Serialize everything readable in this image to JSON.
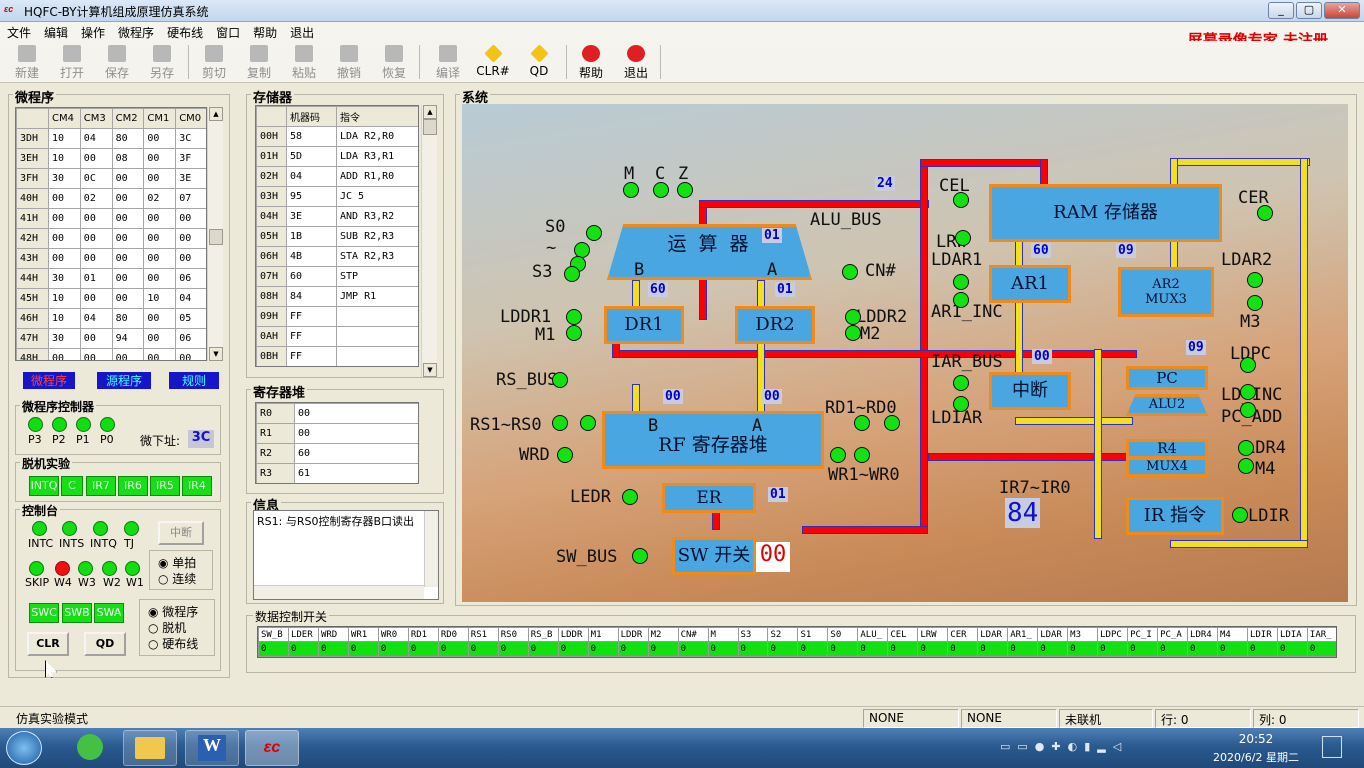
{
  "window": {
    "title": "HQFC-BY计算机组成原理仿真系统",
    "min": "_",
    "max": "▢",
    "close": "✕"
  },
  "menu": [
    "文件",
    "编辑",
    "操作",
    "微程序",
    "硬布线",
    "窗口",
    "帮助",
    "退出"
  ],
  "watermark": "屏幕录像专家  未注册",
  "toolbar": {
    "new": "新建",
    "open": "打开",
    "save": "保存",
    "saveas": "另存",
    "cut": "剪切",
    "copy": "复制",
    "paste": "粘贴",
    "undo": "撤销",
    "redo": "恢复",
    "compile": "编译",
    "clr": "CLR#",
    "qd": "QD",
    "help": "帮助",
    "exit": "退出"
  },
  "micro": {
    "title": "微程序",
    "headers": [
      "CM4",
      "CM3",
      "CM2",
      "CM1",
      "CM0"
    ],
    "rows": [
      [
        "3DH",
        "10",
        "04",
        "80",
        "00",
        "3C"
      ],
      [
        "3EH",
        "10",
        "00",
        "08",
        "00",
        "3F"
      ],
      [
        "3FH",
        "30",
        "0C",
        "00",
        "00",
        "3E"
      ],
      [
        "40H",
        "00",
        "02",
        "00",
        "02",
        "07"
      ],
      [
        "41H",
        "00",
        "00",
        "00",
        "00",
        "00"
      ],
      [
        "42H",
        "00",
        "00",
        "00",
        "00",
        "00"
      ],
      [
        "43H",
        "00",
        "00",
        "00",
        "00",
        "00"
      ],
      [
        "44H",
        "30",
        "01",
        "00",
        "00",
        "06"
      ],
      [
        "45H",
        "10",
        "00",
        "00",
        "10",
        "04"
      ],
      [
        "46H",
        "10",
        "04",
        "80",
        "00",
        "05"
      ],
      [
        "47H",
        "30",
        "00",
        "94",
        "00",
        "06"
      ],
      [
        "48H",
        "00",
        "00",
        "00",
        "00",
        "00"
      ]
    ],
    "links": [
      "微程序",
      "源程序",
      "规则"
    ]
  },
  "mpc": {
    "title": "微程序控制器",
    "leds": [
      "P3",
      "P2",
      "P1",
      "P0"
    ],
    "addr_label": "微下址:",
    "addr": "3C"
  },
  "offline": {
    "title": "脱机实验",
    "switches": [
      "INTQ",
      "C",
      "IR7",
      "IR6",
      "IR5",
      "IR4"
    ]
  },
  "console": {
    "title": "控制台",
    "leds1": [
      "INTC",
      "INTS",
      "INTQ",
      "TJ"
    ],
    "leds2": [
      "SKIP",
      "W4",
      "W3",
      "W2",
      "W1"
    ],
    "int_button": "中断",
    "step": "单拍",
    "cont": "连续",
    "sw": [
      "SWC",
      "SWB",
      "SWA"
    ],
    "clr": "CLR",
    "qd": "QD",
    "modes": [
      "微程序",
      "脱机",
      "硬布线"
    ]
  },
  "memory": {
    "title": "存储器",
    "headers": [
      "机器码",
      "指令"
    ],
    "rows": [
      [
        "00H",
        "58",
        "LDA R2,R0"
      ],
      [
        "01H",
        "5D",
        "LDA R3,R1"
      ],
      [
        "02H",
        "04",
        "ADD R1,R0"
      ],
      [
        "03H",
        "95",
        "JC 5"
      ],
      [
        "04H",
        "3E",
        "AND R3,R2"
      ],
      [
        "05H",
        "1B",
        "SUB R2,R3"
      ],
      [
        "06H",
        "4B",
        "STA R2,R3"
      ],
      [
        "07H",
        "60",
        "STP"
      ],
      [
        "08H",
        "84",
        "JMP R1"
      ],
      [
        "09H",
        "FF",
        ""
      ],
      [
        "0AH",
        "FF",
        ""
      ],
      [
        "0BH",
        "FF",
        ""
      ]
    ]
  },
  "regs": {
    "title": "寄存器堆",
    "rows": [
      [
        "R0",
        "00"
      ],
      [
        "R1",
        "00"
      ],
      [
        "R2",
        "60"
      ],
      [
        "R3",
        "61"
      ]
    ]
  },
  "info": {
    "title": "信息",
    "text": "RS1: 与RS0控制寄存器B口读出"
  },
  "system": {
    "title": "系统",
    "boxes": {
      "alu": "运 算 器",
      "ram": "RAM 存储器",
      "ar1": "AR1",
      "ar2": "AR2\nMUX3",
      "dr1": "DR1",
      "dr2": "DR2",
      "int": "中断",
      "pc": "PC",
      "alu2": "ALU2",
      "r4": "R4",
      "mux4": "MUX4",
      "rf": "RF 寄存器堆",
      "er": "ER",
      "ir": "IR 指令",
      "swbox": "SW 开关"
    },
    "values": {
      "v24": "24",
      "v01a": "01",
      "v60a": "60",
      "v01b": "01",
      "v60b": "60",
      "v09a": "09",
      "v00a": "00",
      "v00b": "00",
      "v00c": "00",
      "v09b": "09",
      "v01c": "01",
      "ir_val": "84",
      "sw_val": "00"
    },
    "labels": {
      "m": "M",
      "c": "C",
      "z": "Z",
      "s0": "S0",
      "tilde": "~",
      "s3": "S3",
      "alu_bus": "ALU_BUS",
      "cn": "CN#",
      "b1": "B",
      "a1": "A",
      "cel": "CEL",
      "lrw": "LRW",
      "cer": "CER",
      "ldar1": "LDAR1",
      "ar1inc": "AR1_INC",
      "ldar2": "LDAR2",
      "m3": "M3",
      "lddr1": "LDDR1",
      "m1": "M1",
      "lddr2": "LDDR2",
      "m2": "M2",
      "ldpc": "LDPC",
      "ldinc": "LD_INC",
      "pcadd": "PC_ADD",
      "iarbus": "IAR_BUS",
      "ldiar": "LDIAR",
      "rsbus": "RS_BUS",
      "rs": "RS1~RS0",
      "rd": "RD1~RD0",
      "wrd": "WRD",
      "wr": "WR1~WR0",
      "b2": "B",
      "a2": "A",
      "ldr4": "LDR4",
      "m4": "M4",
      "ir": "IR7~IR0",
      "ledr": "LEDR",
      "ldir": "LDIR",
      "swbus": "SW_BUS"
    }
  },
  "data_switch": {
    "title": "数据控制开关",
    "names": [
      "SW_B",
      "LDER",
      "WRD",
      "WR1",
      "WR0",
      "RD1",
      "RD0",
      "RS1",
      "RS0",
      "RS_B",
      "LDDR",
      "M1",
      "LDDR",
      "M2",
      "CN#",
      "M",
      "S3",
      "S2",
      "S1",
      "S0",
      "ALU_",
      "CEL",
      "LRW",
      "CER",
      "LDAR",
      "AR1_",
      "LDAR",
      "M3",
      "LDPC",
      "PC_I",
      "PC_A",
      "LDR4",
      "M4",
      "LDIR",
      "LDIA",
      "IAR_"
    ],
    "values": [
      "0",
      "0",
      "0",
      "0",
      "0",
      "0",
      "0",
      "0",
      "0",
      "0",
      "0",
      "0",
      "0",
      "0",
      "0",
      "0",
      "0",
      "0",
      "0",
      "0",
      "0",
      "0",
      "0",
      "0",
      "0",
      "0",
      "0",
      "0",
      "0",
      "0",
      "0",
      "0",
      "0",
      "0",
      "0",
      "0"
    ]
  },
  "status": {
    "mode": "仿真实验模式",
    "p1": "NONE",
    "p2": "NONE",
    "p3": "未联机",
    "row": "行: 0",
    "col": "列: 0"
  },
  "taskbar": {
    "time": "20:52",
    "date": "2020/6/2 星期二"
  }
}
